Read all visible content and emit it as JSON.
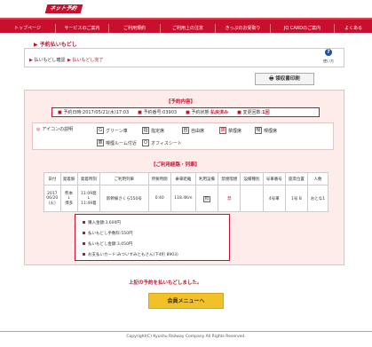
{
  "header": {
    "logo": "ネット予約"
  },
  "nav": [
    {
      "label": "トップページ"
    },
    {
      "label": "サービスのご案内"
    },
    {
      "label": "ご利用規約"
    },
    {
      "label": "ご利用上の注意"
    },
    {
      "label": "きっぷのお受取り"
    },
    {
      "label": "JQ CARDのご案内"
    },
    {
      "label": "よくある"
    }
  ],
  "page": {
    "title": "予約払いもどし"
  },
  "steps": {
    "step1": "払いもどし確認",
    "step2": "払いもどし完了"
  },
  "help": {
    "icon": "?",
    "label": "使い方"
  },
  "receipt": {
    "label": "領収書印刷"
  },
  "reservation": {
    "title": "【予約内容】",
    "date": "予約日時:2017/05/21(水)17:03",
    "number": "予約番号:03903",
    "status_label": "予約状態:",
    "status_value": "払戻済み",
    "change_label": "変更回数:",
    "change_value": "1回"
  },
  "icons_legend": {
    "label": "アイコンの説明",
    "items": [
      {
        "mark": "G",
        "label": "グリーン車"
      },
      {
        "mark": "指",
        "label": "指定席"
      },
      {
        "mark": "自",
        "label": "自由席"
      },
      {
        "mark": "禁",
        "label": "禁煙席"
      },
      {
        "mark": "喫",
        "label": "喫煙席"
      },
      {
        "mark": "車",
        "label": "喫煙ルーム付近"
      },
      {
        "mark": "O",
        "label": "オフィスシート"
      }
    ]
  },
  "route": {
    "title": "【ご利用経路・列車】",
    "headers": [
      "日付",
      "発着駅",
      "発着時刻",
      "ご利用列車",
      "所要時間",
      "乗車距離",
      "利用設備",
      "禁煙喫煙",
      "設備種別",
      "号車番号",
      "座席位置",
      "人数"
    ],
    "row": {
      "date": "2017\n06/20\n(火)",
      "stations": "熊本\n↓\n博多",
      "times": "11:09発\n↓\n11:49着",
      "train": "新幹線さくら550号",
      "duration": "0:40",
      "distance": "118.4Km",
      "facility": "指",
      "smoking": "禁",
      "type": "",
      "car": "4号車",
      "seat": "1号 B",
      "persons": "おとな1"
    }
  },
  "payment": {
    "items": [
      "購入金額:3,600円",
      "払いもどし手数料:550円",
      "払いもどし金額:3,050円",
      "お支払いカード:みついすみともさん(下4桁 8903)"
    ]
  },
  "notice": "上記の予約を払いもどしました。",
  "member_button": "会員メニューへ",
  "footer": {
    "copyright": "Copyright(C) Kyushu Railway Company All Rights Reserved."
  },
  "colors": {
    "brand": "#c8102e",
    "accent": "#f2c029"
  }
}
